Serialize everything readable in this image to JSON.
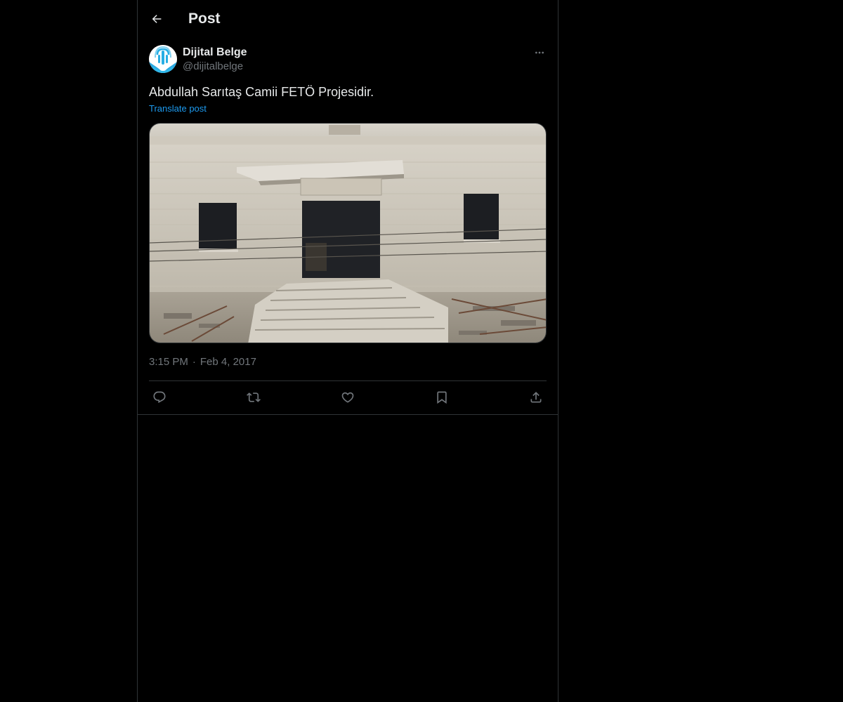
{
  "header": {
    "title": "Post"
  },
  "post": {
    "author_name": "Dijital Belge",
    "author_handle": "@dijitalbelge",
    "text": "Abdullah Sarıtaş Camii FETÖ Projesidir.",
    "translate_label": "Translate post",
    "time": "3:15 PM",
    "separator": "·",
    "date": "Feb 4, 2017"
  },
  "icons": {
    "back": "arrow-left-icon",
    "more": "more-horizontal-icon",
    "reply": "reply-icon",
    "repost": "repost-icon",
    "like": "heart-icon",
    "bookmark": "bookmark-icon",
    "share": "share-icon"
  },
  "colors": {
    "background": "#000000",
    "text": "#e7e9ea",
    "secondary": "#71767b",
    "link": "#1d9bf0",
    "border": "#2f3336"
  }
}
